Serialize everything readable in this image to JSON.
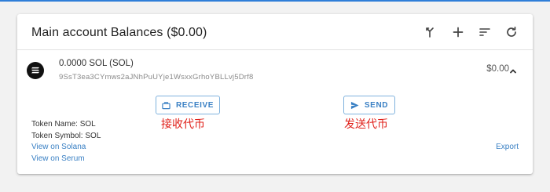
{
  "header": {
    "title": "Main account Balances ($0.00)",
    "icons": [
      "merge-icon",
      "plus-icon",
      "sort-icon",
      "refresh-icon"
    ]
  },
  "account": {
    "name": "0.0000 SOL (SOL)",
    "address": "9SsT3ea3CYmws2aJNhPuUYje1WsxxGrhoYBLLvj5Drf8",
    "value": "$0.00"
  },
  "actions": {
    "receive_label": "RECEIVE",
    "send_label": "SEND"
  },
  "annotations": {
    "receive": "接收代币",
    "send": "发送代币"
  },
  "token": {
    "name_line": "Token Name: SOL",
    "symbol_line": "Token Symbol: SOL",
    "view_solana": "View on Solana",
    "view_serum": "View on Serum",
    "export": "Export"
  },
  "colors": {
    "accent": "#3a80c4",
    "annotation": "#e0201a",
    "top_bar": "#2f7ed8"
  }
}
